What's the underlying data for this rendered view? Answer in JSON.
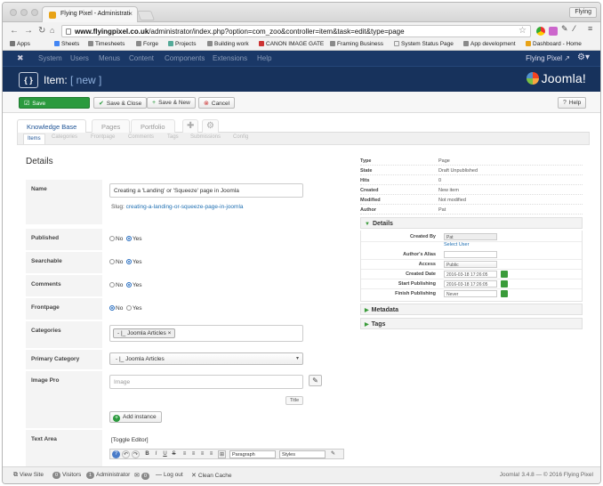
{
  "browser": {
    "tab_title": "Flying Pixel - Administrati",
    "tab_close": "×",
    "profile": "Flying",
    "url_host": "www.flyingpixel.co.uk",
    "url_path": "/administrator/index.php?option=com_zoo&controller=item&task=edit&type=page",
    "bookmarks": [
      "Apps",
      "Sheets",
      "Timesheets",
      "Forge",
      "Projects",
      "Building work",
      "CANON IMAGE GATE",
      "Framing Business",
      "System Status Page",
      "App development",
      "Dashboard - Home"
    ]
  },
  "admin_menu": {
    "items": [
      "System",
      "Users",
      "Menus",
      "Content",
      "Components",
      "Extensions",
      "Help"
    ],
    "site_name": "Flying Pixel ↗"
  },
  "header": {
    "icon_text": "{ }",
    "title": "Item:",
    "title_new": "[ new ]",
    "brand": "Joomla!"
  },
  "toolbar": {
    "save": "Save",
    "save_close": "Save & Close",
    "save_new": "Save & New",
    "cancel": "Cancel",
    "help": "Help"
  },
  "main_tabs": [
    "Knowledge Base",
    "Pages",
    "Portfolio"
  ],
  "sub_tabs": [
    "Items",
    "Categories",
    "Frontpage",
    "Comments",
    "Tags",
    "Submissions",
    "Config"
  ],
  "form": {
    "heading": "Details",
    "name_label": "Name",
    "name_value": "Creating a 'Landing' or 'Squeeze' page in Joomla",
    "slug_prefix": "Slug:",
    "slug_value": "creating-a-landing-or-squeeze-page-in-joomla",
    "published_label": "Published",
    "searchable_label": "Searchable",
    "comments_label": "Comments",
    "frontpage_label": "Frontpage",
    "no": "No",
    "yes": "Yes",
    "categories_label": "Categories",
    "categories_chip": "- |_ Joomla Articles ×",
    "primary_category_label": "Primary Category",
    "primary_category_value": "- |_ Joomla Articles",
    "image_pro_label": "Image Pro",
    "image_placeholder": "Image",
    "title_btn": "Title",
    "add_instance": "Add instance",
    "text_area_label": "Text Area",
    "toggle_editor": "[Toggle Editor]",
    "paragraph": "Paragraph",
    "styles": "Styles"
  },
  "info": {
    "rows": [
      {
        "k": "Type",
        "v": "Page"
      },
      {
        "k": "State",
        "v": "Draft Unpublished"
      },
      {
        "k": "Hits",
        "v": "0"
      },
      {
        "k": "Created",
        "v": "New item"
      },
      {
        "k": "Modified",
        "v": "Not modified"
      },
      {
        "k": "Author",
        "v": "Pat"
      }
    ]
  },
  "details_panel": {
    "title": "Details",
    "created_by_label": "Created By",
    "created_by_value": "Pat",
    "select_user": "Select User",
    "alias_label": "Author's Alias",
    "access_label": "Access",
    "access_value": "Public",
    "created_date_label": "Created Date",
    "created_date_value": "2016-03-18 17:26:05",
    "start_pub_label": "Start Publishing",
    "start_pub_value": "2016-03-18 17:26:05",
    "finish_pub_label": "Finish Publishing",
    "finish_pub_value": "Never"
  },
  "metadata_title": "Metadata",
  "tags_title": "Tags",
  "status": {
    "view_site": "View Site",
    "visitors_count": "0",
    "visitors": "Visitors",
    "admin_count": "1",
    "admin": "Administrator",
    "messages_count": "0",
    "logout": "Log out",
    "clean_cache": "Clean Cache",
    "copyright": "Joomla! 3.4.8 — © 2016 Flying Pixel"
  }
}
